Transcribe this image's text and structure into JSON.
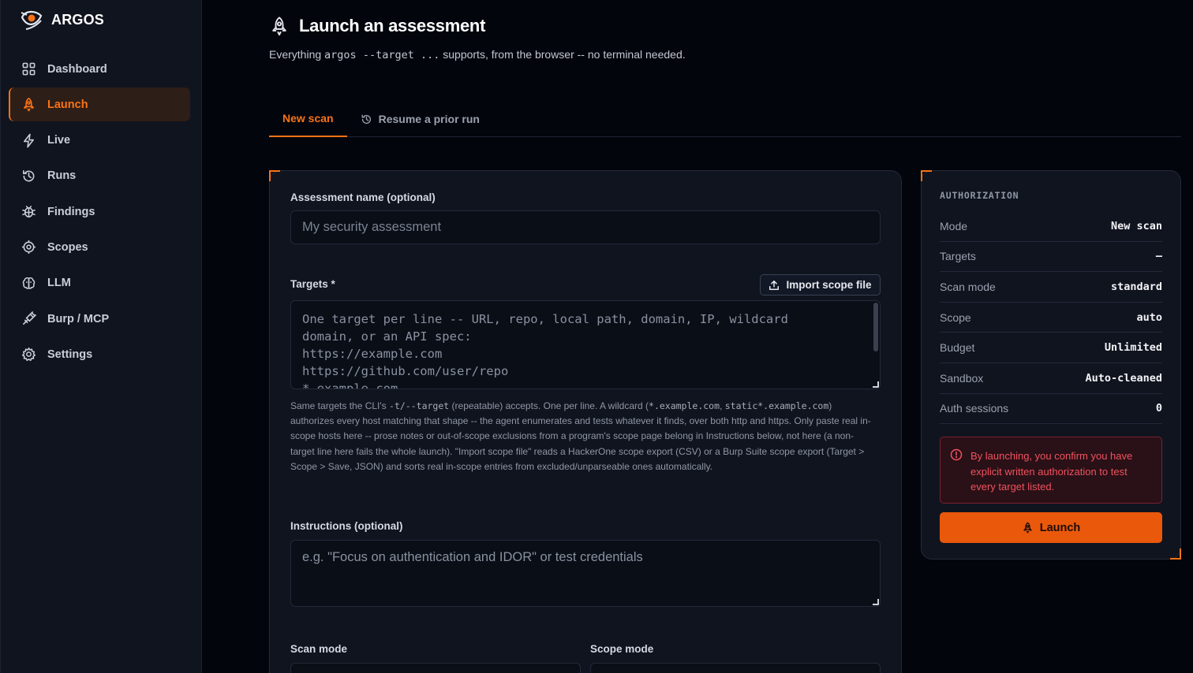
{
  "brand": {
    "name": "ARGOS"
  },
  "sidebar": {
    "items": [
      {
        "label": "Dashboard",
        "icon": "grid-icon"
      },
      {
        "label": "Launch",
        "icon": "rocket-icon",
        "active": true
      },
      {
        "label": "Live",
        "icon": "bolt-icon"
      },
      {
        "label": "Runs",
        "icon": "history-icon"
      },
      {
        "label": "Findings",
        "icon": "bug-icon"
      },
      {
        "label": "Scopes",
        "icon": "target-icon"
      },
      {
        "label": "LLM",
        "icon": "brain-icon"
      },
      {
        "label": "Burp / MCP",
        "icon": "plug-icon"
      },
      {
        "label": "Settings",
        "icon": "gear-icon"
      }
    ]
  },
  "header": {
    "title": "Launch an assessment",
    "subtitle_pre": "Everything",
    "subtitle_code": "argos --target ...",
    "subtitle_post": "supports, from the browser -- no terminal needed."
  },
  "tabs": [
    {
      "label": "New scan",
      "active": true
    },
    {
      "label": "Resume a prior run",
      "icon": "history-icon"
    }
  ],
  "form": {
    "name_label": "Assessment name (optional)",
    "name_placeholder": "My security assessment",
    "targets_label": "Targets *",
    "import_button": "Import scope file",
    "targets_placeholder": "One target per line -- URL, repo, local path, domain, IP, wildcard\ndomain, or an API spec:\nhttps://example.com\nhttps://github.com/user/repo\n*.example.com",
    "help": {
      "p1": "Same targets the CLI's",
      "c1": "-t/--target",
      "p2": "(repeatable) accepts. One per line. A wildcard (",
      "c2": "*.example.com",
      "p3": ",",
      "c3": "static*.example.com",
      "p4": ") authorizes every host matching that shape -- the agent enumerates and tests whatever it finds, over both http and https. Only paste real in-scope hosts here -- prose notes or out-of-scope exclusions from a program's scope page belong in Instructions below, not here (a non-target line here fails the whole launch). \"Import scope file\" reads a HackerOne scope export (CSV) or a Burp Suite scope export (Target > Scope > Save, JSON) and sorts real in-scope entries from excluded/unparseable ones automatically."
    },
    "instructions_label": "Instructions (optional)",
    "instructions_placeholder": "e.g. \"Focus on authentication and IDOR\" or test credentials",
    "scan_mode_label": "Scan mode",
    "scope_mode_label": "Scope mode"
  },
  "auth": {
    "title": "AUTHORIZATION",
    "rows": [
      {
        "k": "Mode",
        "v": "New scan"
      },
      {
        "k": "Targets",
        "v": "—"
      },
      {
        "k": "Scan mode",
        "v": "standard"
      },
      {
        "k": "Scope",
        "v": "auto"
      },
      {
        "k": "Budget",
        "v": "Unlimited"
      },
      {
        "k": "Sandbox",
        "v": "Auto-cleaned"
      },
      {
        "k": "Auth sessions",
        "v": "0"
      }
    ],
    "warning": "By launching, you confirm you have explicit written authorization to test every target listed.",
    "launch_button": "Launch"
  },
  "colors": {
    "accent": "#f97316",
    "danger": "#f0525e",
    "bg": "#03050c",
    "panel": "#10141f"
  }
}
